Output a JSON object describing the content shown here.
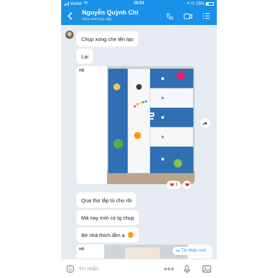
{
  "status_bar": {
    "carrier": "Viettel",
    "time": "10:51",
    "battery": "25%"
  },
  "header": {
    "name": "Nguyễn Quỳnh Chi",
    "presence": "Vừa mới truy cập"
  },
  "messages": [
    {
      "text": "Chụp xong che tên lạo"
    },
    {
      "text": "Lại"
    },
    {
      "text": "Qua thợ lắp tủ cho rồi"
    },
    {
      "text": "Mà nay mới có tg chụp"
    },
    {
      "text": "Bé nhà thích lắm ạ"
    }
  ],
  "photo": {
    "quality_label": "HD",
    "reaction_count": "1"
  },
  "photo2": {
    "quality_label": "HD"
  },
  "new_messages_label": "Tin nhắn mới",
  "input": {
    "placeholder": "Tin nhắn"
  },
  "colors": {
    "brand": "#1a91e8",
    "chat_bg": "#e6ebf2",
    "heart": "#e53935"
  },
  "icons": {
    "back": "chevron-left-icon",
    "call": "phone-icon",
    "video": "video-icon",
    "menu": "list-icon",
    "share": "share-icon",
    "emoji": "emoji-icon",
    "more": "more-icon",
    "mic": "mic-icon",
    "image": "image-icon"
  }
}
